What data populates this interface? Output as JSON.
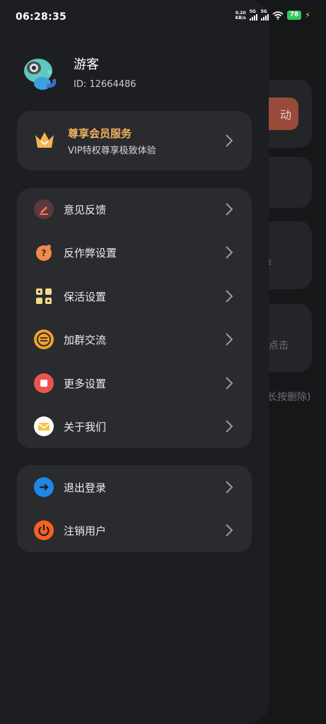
{
  "status_bar": {
    "time": "06:28:35",
    "net_speed_value": "0.20",
    "net_speed_unit": "KB/s",
    "sim1": "5G",
    "sim2": "5G",
    "battery": "78"
  },
  "background": {
    "button_partial": "动",
    "text1": "作",
    "text2": "点击",
    "text3": "长按删除)"
  },
  "profile": {
    "name": "游客",
    "id": "ID: 12664486"
  },
  "vip": {
    "title": "尊享会员服务",
    "subtitle": "VIP特权尊享极致体验"
  },
  "menu": [
    {
      "label": "意见反馈",
      "icon": "feedback-icon",
      "color": "#5a3a3a"
    },
    {
      "label": "反作弊设置",
      "icon": "anti-cheat-icon",
      "color": "#f08a4b"
    },
    {
      "label": "保活设置",
      "icon": "keep-alive-icon",
      "color": "#f5d98a"
    },
    {
      "label": "加群交流",
      "icon": "group-chat-icon",
      "color": "#f3a12a"
    },
    {
      "label": "更多设置",
      "icon": "more-settings-icon",
      "color": "#ef5350"
    },
    {
      "label": "关于我们",
      "icon": "about-mail-icon",
      "color": "#f6c544"
    }
  ],
  "account": [
    {
      "label": "退出登录",
      "icon": "logout-icon",
      "color": "#1e88e5"
    },
    {
      "label": "注销用户",
      "icon": "power-icon",
      "color": "#f26322"
    }
  ]
}
